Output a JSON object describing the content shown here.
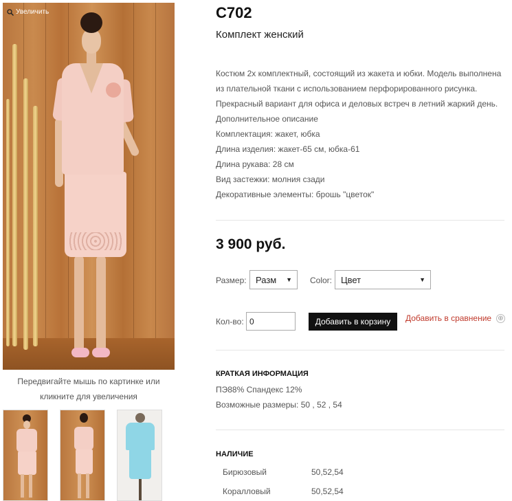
{
  "gallery": {
    "zoom_label": "Увеличить",
    "caption_line1": "Передвигайте мышь по картинке или",
    "caption_line2": "кликните для увеличения"
  },
  "product": {
    "sku": "C702",
    "title": "Комплект женский",
    "description": [
      "Костюм 2х комплектный, состоящий из жакета и юбки. Модель выполнена",
      "из плательной ткани с использованием перфорированного рисунка.",
      "Прекрасный вариант для офиса и деловых встреч в летний жаркий день.",
      "Дополнительное описание",
      "Комплектация: жакет, юбка",
      "Длина изделия: жакет-65 см, юбка-61",
      "Длина рукава: 28 см",
      "Вид застежки: молния сзади",
      "Декоративные элементы: брошь \"цветок\""
    ],
    "price": "3 900 руб."
  },
  "options": {
    "size_label": "Размер:",
    "size_value": "Разм",
    "color_label": "Color:",
    "color_value": "Цвет"
  },
  "purchase": {
    "qty_label": "Кол-во:",
    "qty_value": "0",
    "add_to_cart": "Добавить в корзину",
    "add_to_compare": "Добавить в сравнение",
    "compare_icon": "⊕"
  },
  "short_info": {
    "heading": "КРАТКАЯ ИНФОРМАЦИЯ",
    "composition": "ПЭ88% Спандекс 12%",
    "sizes": "Возможные размеры: 50 , 52 , 54"
  },
  "availability": {
    "heading": "НАЛИЧИЕ",
    "rows": [
      {
        "color": "Бирюзовый",
        "sizes": "50,52,54"
      },
      {
        "color": "Коралловый",
        "sizes": "50,52,54"
      }
    ]
  },
  "colors": {
    "accent_link": "#c0392b",
    "button_bg": "#111111",
    "suit_pink": "#f4cfc5",
    "suit_turquoise": "#8fd6e6"
  }
}
